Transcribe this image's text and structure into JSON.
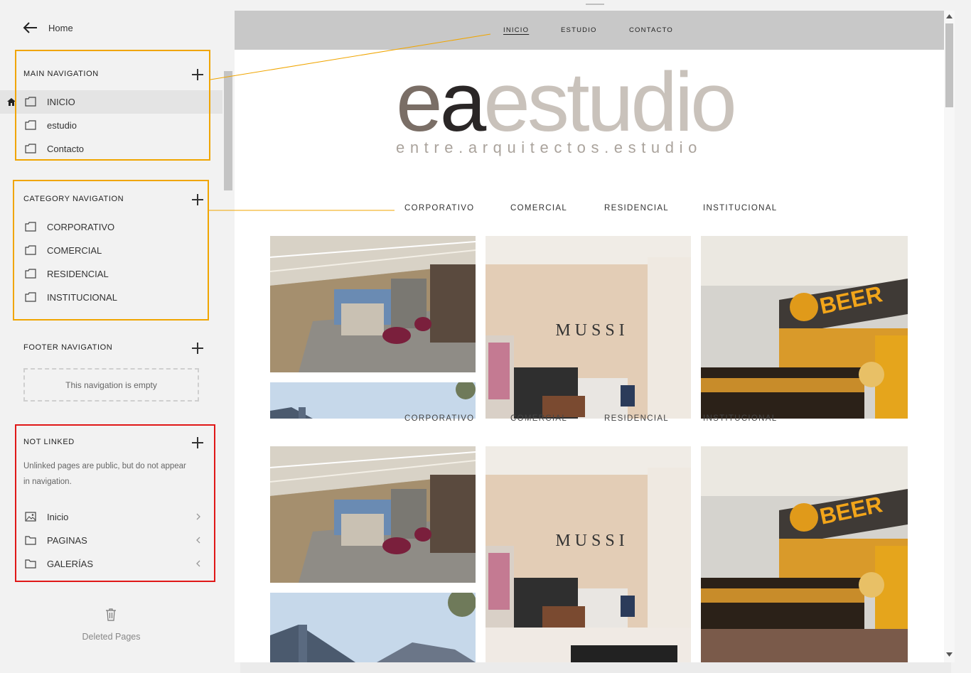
{
  "sidebar": {
    "back_label": "Home",
    "main_navigation": {
      "title": "MAIN NAVIGATION",
      "items": [
        {
          "label": "INICIO",
          "active": true
        },
        {
          "label": "estudio"
        },
        {
          "label": "Contacto"
        }
      ]
    },
    "category_navigation": {
      "title": "CATEGORY NAVIGATION",
      "items": [
        {
          "label": "CORPORATIVO"
        },
        {
          "label": "COMERCIAL"
        },
        {
          "label": "RESIDENCIAL"
        },
        {
          "label": "INSTITUCIONAL"
        }
      ]
    },
    "footer_navigation": {
      "title": "FOOTER NAVIGATION",
      "empty_text": "This navigation is empty"
    },
    "not_linked": {
      "title": "NOT LINKED",
      "description": "Unlinked pages are public, but do not appear in navigation.",
      "items": [
        {
          "label": "Inicio",
          "icon": "gallery-page-icon",
          "chevron": "chevron-right-icon"
        },
        {
          "label": "PAGINAS",
          "icon": "folder-icon",
          "chevron": "chevron-left-icon"
        },
        {
          "label": "GALERÍAS",
          "icon": "folder-icon",
          "chevron": "chevron-left-icon"
        }
      ]
    },
    "deleted_label": "Deleted Pages"
  },
  "preview": {
    "site_nav": [
      "INICIO",
      "ESTUDIO",
      "CONTACTO"
    ],
    "current_page": "INICIO",
    "logo": {
      "part_dark": "ea",
      "part_light": "estudio",
      "tagline": "entre.arquitectos.estudio"
    },
    "category_nav": [
      "CORPORATIVO",
      "COMERCIAL",
      "RESIDENCIAL",
      "INSTITUCIONAL"
    ],
    "store_sign": "MUSSI",
    "bar_sign": "BEER"
  },
  "colors": {
    "highlight_orange": "#f0a500",
    "highlight_red": "#e01818",
    "header_bg": "#c8c8c8",
    "logo_dark": "#2a2626",
    "logo_mid": "#7a6e66",
    "logo_light": "#c9c2bb"
  }
}
